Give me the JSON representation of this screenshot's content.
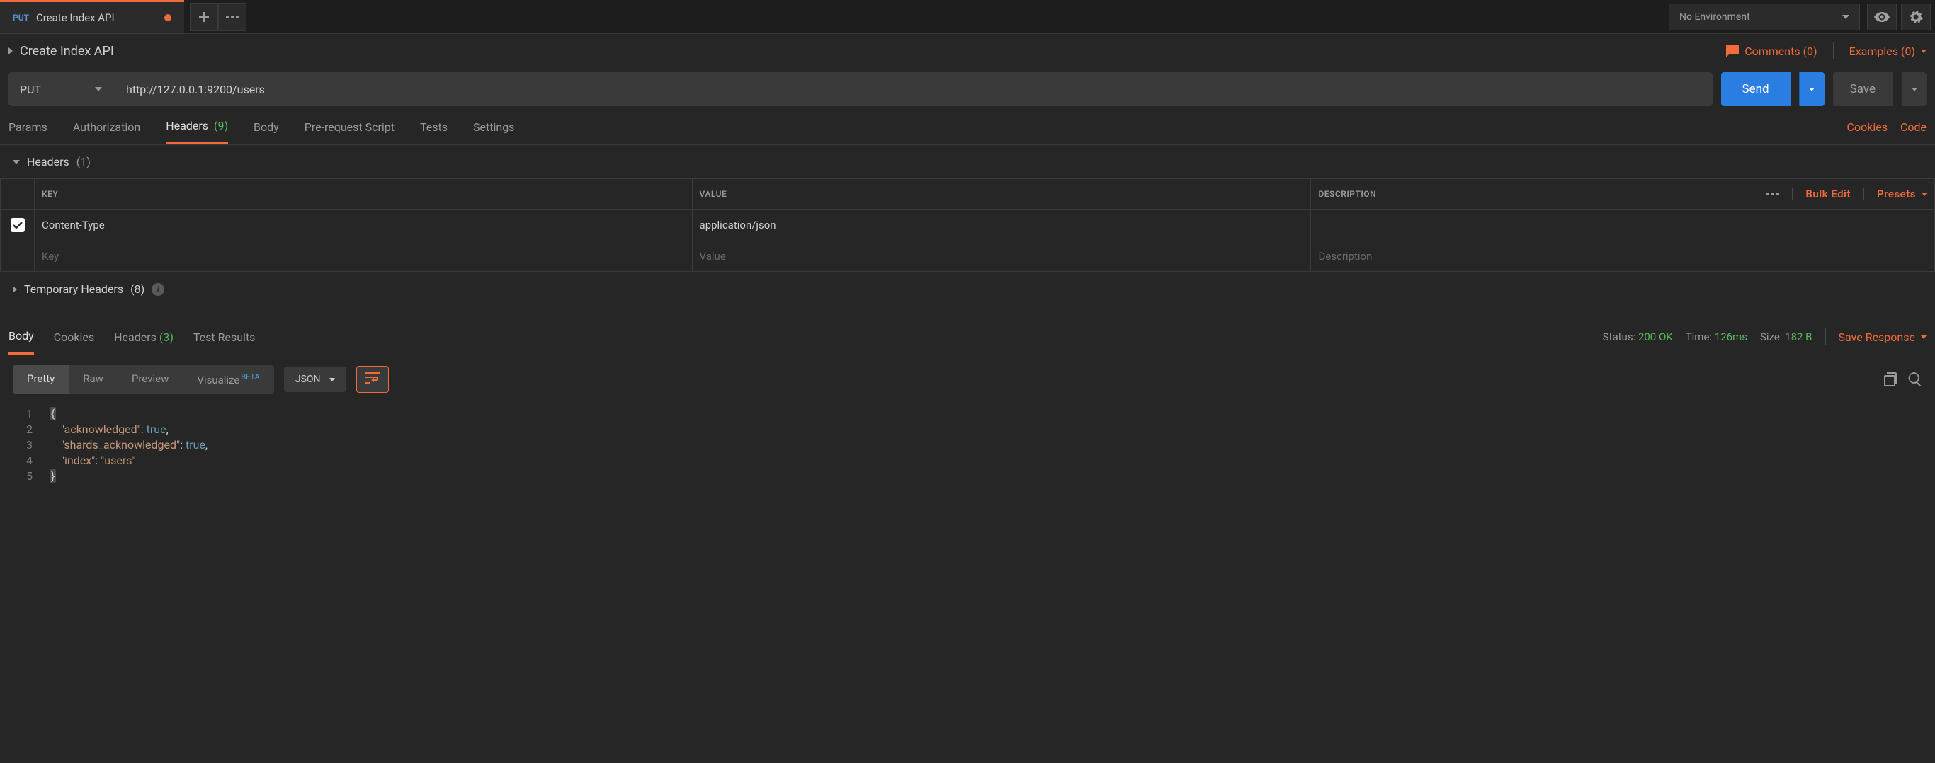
{
  "tab": {
    "method": "PUT",
    "title": "Create Index API",
    "dirty": true
  },
  "environment": {
    "selected": "No Environment"
  },
  "request_title": "Create Index API",
  "comments": {
    "label": "Comments (0)"
  },
  "examples": {
    "label": "Examples (0)"
  },
  "request": {
    "method": "PUT",
    "url": "http://127.0.0.1:9200/users"
  },
  "buttons": {
    "send": "Send",
    "save": "Save"
  },
  "req_tabs": {
    "params": "Params",
    "authorization": "Authorization",
    "headers": "Headers",
    "headers_count": "(9)",
    "body": "Body",
    "prescript": "Pre-request Script",
    "tests": "Tests",
    "settings": "Settings"
  },
  "req_links": {
    "cookies": "Cookies",
    "code": "Code"
  },
  "headers_section": {
    "label": "Headers",
    "count": "(1)"
  },
  "headers_table": {
    "cols": {
      "key": "KEY",
      "value": "VALUE",
      "description": "DESCRIPTION"
    },
    "actions": {
      "bulk_edit": "Bulk Edit",
      "presets": "Presets"
    },
    "rows": [
      {
        "checked": true,
        "key": "Content-Type",
        "value": "application/json",
        "description": ""
      }
    ],
    "placeholders": {
      "key": "Key",
      "value": "Value",
      "description": "Description"
    }
  },
  "temp_headers": {
    "label": "Temporary Headers",
    "count": "(8)"
  },
  "resp_tabs": {
    "body": "Body",
    "cookies": "Cookies",
    "headers": "Headers",
    "headers_count": "(3)",
    "test_results": "Test Results"
  },
  "resp_status": {
    "status_label": "Status:",
    "status_value": "200 OK",
    "time_label": "Time:",
    "time_value": "126ms",
    "size_label": "Size:",
    "size_value": "182 B",
    "save_response": "Save Response"
  },
  "view": {
    "pretty": "Pretty",
    "raw": "Raw",
    "preview": "Preview",
    "visualize": "Visualize",
    "beta": "BETA",
    "format": "JSON"
  },
  "response_body": {
    "acknowledged": true,
    "shards_acknowledged": true,
    "index": "users"
  }
}
